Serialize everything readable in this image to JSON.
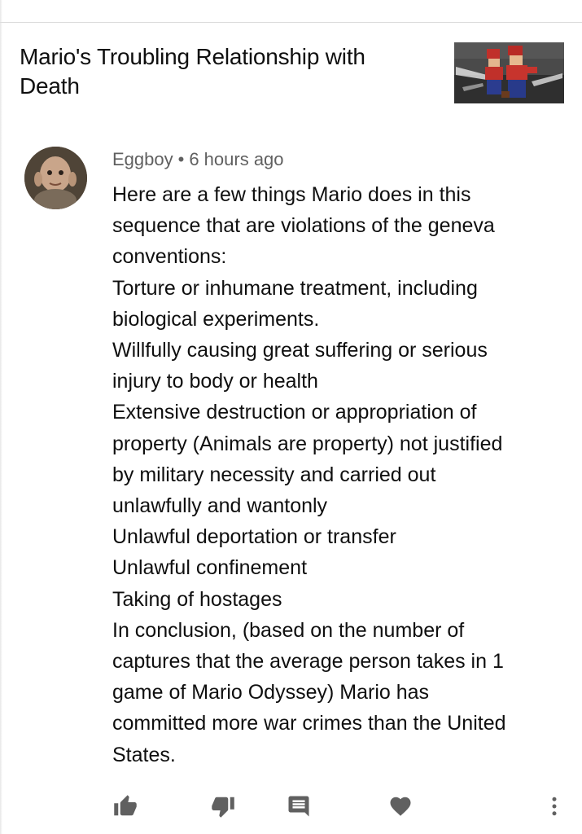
{
  "video": {
    "title": "Mario's Troubling Relationship with Death",
    "thumbnail_icon": "video-thumbnail"
  },
  "comment": {
    "author": "Eggboy",
    "separator": "•",
    "timestamp": "6 hours ago",
    "lines": [
      "Here are a few things Mario does in this",
      "sequence that are violations of the geneva",
      "conventions:",
      "Torture or inhumane treatment, including",
      "biological experiments.",
      "Willfully causing great suffering or serious",
      "injury to body or health",
      "Extensive destruction or appropriation of",
      "property (Animals are property) not justified",
      "by military necessity and carried out",
      "unlawfully and wantonly",
      "Unlawful deportation or transfer",
      "Unlawful confinement",
      "Taking of hostages",
      "In conclusion, (based on the number of",
      "captures that the average person takes in 1",
      "game of Mario Odyssey) Mario has",
      "committed more war crimes than the United",
      "States."
    ]
  },
  "actions": {
    "icons": [
      "thumbs-up-icon",
      "thumbs-down-icon",
      "reply-icon",
      "heart-icon",
      "more-vert-icon"
    ],
    "icon_color": "#606060"
  },
  "colors": {
    "text": "#0f0f0f",
    "meta": "#606060",
    "divider": "#dcdcdc"
  }
}
